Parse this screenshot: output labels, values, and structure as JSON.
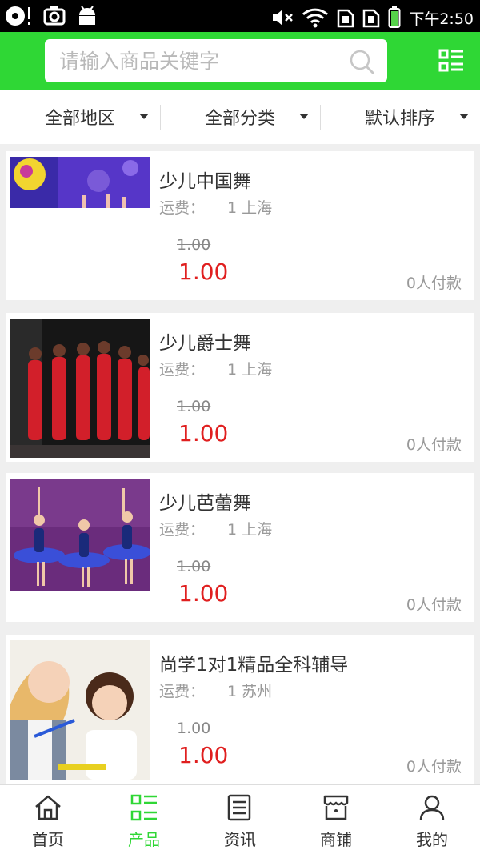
{
  "status": {
    "time": "下午2:50"
  },
  "search": {
    "placeholder": "请输入商品关键字"
  },
  "filters": [
    {
      "label": "全部地区"
    },
    {
      "label": "全部分类"
    },
    {
      "label": "默认排序"
    }
  ],
  "products": [
    {
      "title": "少儿中国舞",
      "shipping_label": "运费：",
      "shipping_value": "1 上海",
      "old_price": "1.00",
      "price": "1.00",
      "paid": "0人付款"
    },
    {
      "title": "少儿爵士舞",
      "shipping_label": "运费：",
      "shipping_value": "1 上海",
      "old_price": "1.00",
      "price": "1.00",
      "paid": "0人付款"
    },
    {
      "title": "少儿芭蕾舞",
      "shipping_label": "运费：",
      "shipping_value": "1 上海",
      "old_price": "1.00",
      "price": "1.00",
      "paid": "0人付款"
    },
    {
      "title": "尚学1对1精品全科辅导",
      "shipping_label": "运费：",
      "shipping_value": "1 苏州",
      "old_price": "1.00",
      "price": "1.00",
      "paid": "0人付款"
    }
  ],
  "tabs": [
    {
      "label": "首页",
      "icon": "home-icon",
      "active": false
    },
    {
      "label": "产品",
      "icon": "grid-list-icon",
      "active": true
    },
    {
      "label": "资讯",
      "icon": "news-icon",
      "active": false
    },
    {
      "label": "商铺",
      "icon": "shop-icon",
      "active": false
    },
    {
      "label": "我的",
      "icon": "user-icon",
      "active": false
    }
  ],
  "colors": {
    "accent": "#2fd735",
    "price": "#e01f1f"
  }
}
